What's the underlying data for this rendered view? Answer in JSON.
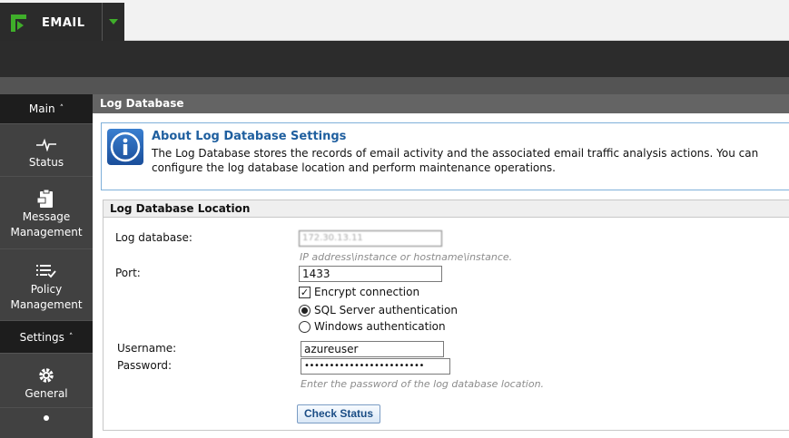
{
  "product": {
    "name": "EMAIL"
  },
  "sidebar": {
    "main_section": "Main",
    "items": [
      {
        "icon": "activity-icon",
        "label": "Status"
      },
      {
        "icon": "clipboard-icon",
        "label": "Message Management"
      },
      {
        "icon": "list-check-icon",
        "label": "Policy Management"
      }
    ],
    "settings_section": "Settings",
    "settings_items": [
      {
        "icon": "gear-icon",
        "label": "General"
      }
    ]
  },
  "page": {
    "title": "Log Database"
  },
  "about": {
    "title": "About Log Database Settings",
    "text": "The Log Database stores the records of email activity and the associated email traffic analysis actions. You can configure the log database location and perform maintenance operations."
  },
  "location": {
    "header": "Log Database Location",
    "log_database_label": "Log database:",
    "log_database_value": "172.30.13.11",
    "log_database_hint": "IP address\\instance or hostname\\instance.",
    "port_label": "Port:",
    "port_value": "1433",
    "encrypt_label": "Encrypt connection",
    "encrypt_checked": true,
    "sql_auth_label": "SQL Server authentication",
    "windows_auth_label": "Windows authentication",
    "selected_auth": "sql",
    "username_label": "Username:",
    "username_value": "azureuser",
    "password_label": "Password:",
    "password_value": "••••••••••••••••••••••••",
    "password_hint": "Enter the password of the log database location.",
    "check_status_label": "Check Status"
  },
  "colors": {
    "brand_green": "#3fae2a",
    "about_border": "#7fb0d9",
    "about_title": "#1f5f9f"
  }
}
